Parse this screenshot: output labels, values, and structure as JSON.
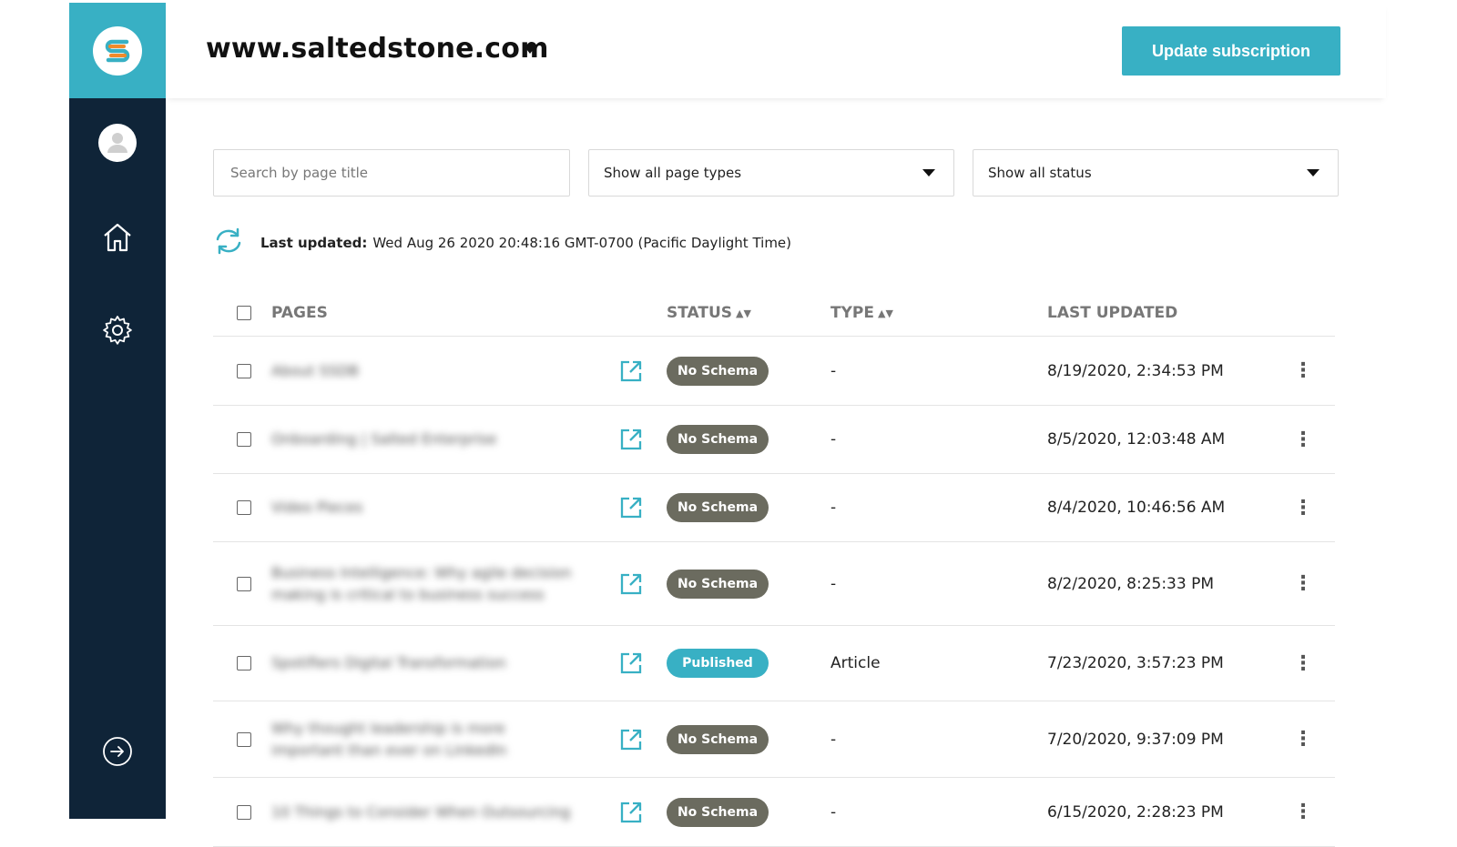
{
  "colors": {
    "accent": "#38b0c4",
    "sidebar": "#0f2438",
    "badge_no_schema": "#6b6b5f",
    "badge_published": "#38b0c4"
  },
  "sidebar": {
    "logo": "s-logo-icon",
    "items": [
      {
        "icon": "user-avatar-icon"
      },
      {
        "icon": "home-icon"
      },
      {
        "icon": "gear-icon"
      },
      {
        "icon": "logout-arrow-icon"
      }
    ]
  },
  "header": {
    "site": "www.saltedstone.com",
    "update_button": "Update subscription"
  },
  "filters": {
    "search_placeholder": "Search by page title",
    "page_types": "Show all page types",
    "status": "Show all status"
  },
  "last_updated": {
    "label": "Last updated:",
    "value": "Wed Aug 26 2020 20:48:16 GMT-0700 (Pacific Daylight Time)"
  },
  "table": {
    "headers": {
      "pages": "PAGES",
      "status": "STATUS",
      "type": "TYPE",
      "last_updated": "LAST UPDATED"
    },
    "rows": [
      {
        "title": "About SSDB",
        "status": "No Schema",
        "type": "-",
        "updated": "8/19/2020, 2:34:53 PM"
      },
      {
        "title": "Onboarding | Salted Enterprise",
        "status": "No Schema",
        "type": "-",
        "updated": "8/5/2020, 12:03:48 AM"
      },
      {
        "title": "Video Pieces",
        "status": "No Schema",
        "type": "-",
        "updated": "8/4/2020, 10:46:56 AM"
      },
      {
        "title": "Business Intelligence: Why agile decision making is critical to business success",
        "status": "No Schema",
        "type": "-",
        "updated": "8/2/2020, 8:25:33 PM"
      },
      {
        "title": "Spotifiers Digital Transformation",
        "status": "Published",
        "type": "Article",
        "updated": "7/23/2020, 3:57:23 PM"
      },
      {
        "title": "Why thought leadership is more important than ever on LinkedIn",
        "status": "No Schema",
        "type": "-",
        "updated": "7/20/2020, 9:37:09 PM"
      },
      {
        "title": "10 Things to Consider When Outsourcing",
        "status": "No Schema",
        "type": "-",
        "updated": "6/15/2020, 2:28:23 PM"
      }
    ]
  }
}
